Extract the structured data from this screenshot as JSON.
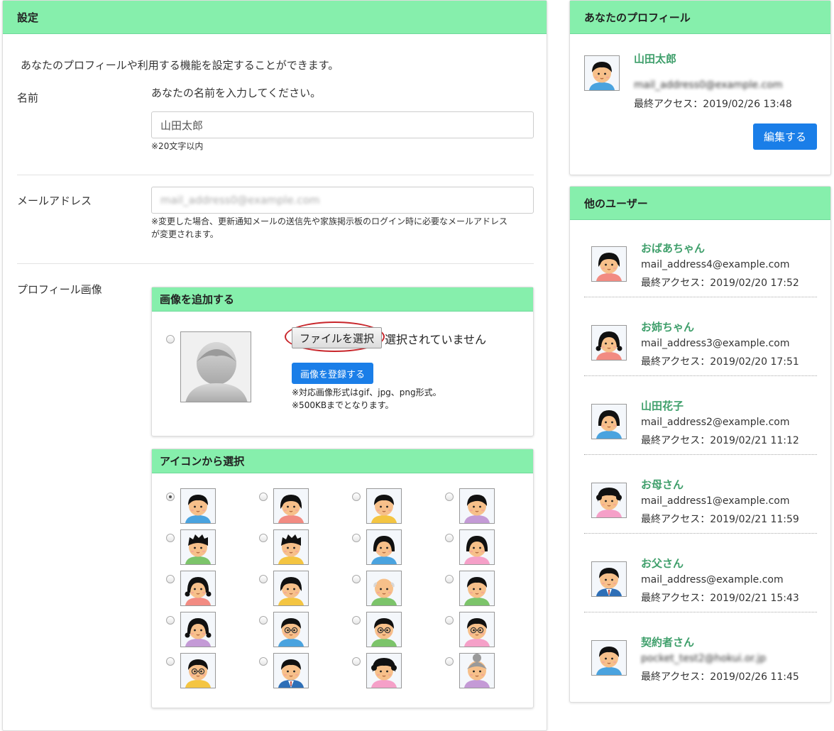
{
  "settings": {
    "title": "設定",
    "intro": "あなたのプロフィールや利用する機能を設定することができます。",
    "name_label": "名前",
    "name_help": "あなたの名前を入力してください。",
    "name_value": "山田太郎",
    "name_note": "※20文字以内",
    "email_label": "メールアドレス",
    "email_value": "mail_address0@example.com",
    "email_note_1": "※変更した場合、更新通知メールの送信先や家族掲示板のログイン時に必要なメールアドレス",
    "email_note_2": "が変更されます。",
    "image_label": "プロフィール画像",
    "add_image": {
      "title": "画像を追加する",
      "choose_file": "ファイルを選択",
      "no_file": "選択されていません",
      "register_button": "画像を登録する",
      "note_1": "※対応画像形式はgif、jpg、png形式。",
      "note_2": "※500KBまでとなります。"
    },
    "icon_select": {
      "title": "アイコンから選択",
      "selected_index": 0,
      "icons": [
        {
          "skin": "#f7c08a",
          "hair": "#111",
          "shirt": "#4aa3df",
          "style": "short"
        },
        {
          "skin": "#f7c08a",
          "hair": "#111",
          "shirt": "#f28b82",
          "style": "bob"
        },
        {
          "skin": "#f7c08a",
          "hair": "#111",
          "shirt": "#f4c542",
          "style": "short"
        },
        {
          "skin": "#f7c08a",
          "hair": "#111",
          "shirt": "#c49ad6",
          "style": "side"
        },
        {
          "skin": "#f7c08a",
          "hair": "#111",
          "shirt": "#7cc46a",
          "style": "spiky"
        },
        {
          "skin": "#f7c08a",
          "hair": "#111",
          "shirt": "#f4c542",
          "style": "spiky"
        },
        {
          "skin": "#f7c08a",
          "hair": "#111",
          "shirt": "#4aa3df",
          "style": "long"
        },
        {
          "skin": "#f7c08a",
          "hair": "#111",
          "shirt": "#f5a0c8",
          "style": "long"
        },
        {
          "skin": "#f7c08a",
          "hair": "#111",
          "shirt": "#f28b82",
          "style": "pigtail"
        },
        {
          "skin": "#f7c08a",
          "hair": "#111",
          "shirt": "#f4c542",
          "style": "bob"
        },
        {
          "skin": "#f7c08a",
          "hair": "#d8d8d8",
          "shirt": "#7cc46a",
          "style": "bald"
        },
        {
          "skin": "#f7c08a",
          "hair": "#111",
          "shirt": "#7cc46a",
          "style": "short"
        },
        {
          "skin": "#f7c08a",
          "hair": "#111",
          "shirt": "#c49ad6",
          "style": "pigtail"
        },
        {
          "skin": "#f7c08a",
          "hair": "#111",
          "shirt": "#4aa3df",
          "style": "glasses"
        },
        {
          "skin": "#f7c08a",
          "hair": "#111",
          "shirt": "#7cc46a",
          "style": "glasses"
        },
        {
          "skin": "#f7c08a",
          "hair": "#111",
          "shirt": "#f5a0c8",
          "style": "glasses"
        },
        {
          "skin": "#f7c08a",
          "hair": "#111",
          "shirt": "#f4c542",
          "style": "glasses"
        },
        {
          "skin": "#f7c08a",
          "hair": "#111",
          "shirt": "#2e6fb7",
          "style": "suit"
        },
        {
          "skin": "#f7c08a",
          "hair": "#111",
          "shirt": "#f5a0c8",
          "style": "curly"
        },
        {
          "skin": "#f7c08a",
          "hair": "#9a9a9a",
          "shirt": "#c49ad6",
          "style": "bun"
        }
      ]
    }
  },
  "profile": {
    "title": "あなたのプロフィール",
    "name": "山田太郎",
    "email": "mail_address0@example.com",
    "last_access": "最終アクセス：2019/02/26 13:48",
    "edit_button": "編集する",
    "avatar": {
      "skin": "#f7c08a",
      "hair": "#111",
      "shirt": "#4aa3df",
      "style": "short"
    }
  },
  "others": {
    "title": "他のユーザー",
    "users": [
      {
        "name": "おばあちゃん",
        "email": "mail_address4@example.com",
        "last_access": "最終アクセス：2019/02/20 17:52",
        "avatar": {
          "skin": "#f7c08a",
          "hair": "#111",
          "shirt": "#f28b82",
          "style": "bob"
        }
      },
      {
        "name": "お姉ちゃん",
        "email": "mail_address3@example.com",
        "last_access": "最終アクセス：2019/02/20 17:51",
        "avatar": {
          "skin": "#f7c08a",
          "hair": "#111",
          "shirt": "#f28b82",
          "style": "pigtail"
        }
      },
      {
        "name": "山田花子",
        "email": "mail_address2@example.com",
        "last_access": "最終アクセス：2019/02/21 11:12",
        "avatar": {
          "skin": "#f7c08a",
          "hair": "#111",
          "shirt": "#4aa3df",
          "style": "long"
        }
      },
      {
        "name": "お母さん",
        "email": "mail_address1@example.com",
        "last_access": "最終アクセス：2019/02/21 11:59",
        "avatar": {
          "skin": "#f7c08a",
          "hair": "#111",
          "shirt": "#f5a0c8",
          "style": "curly"
        }
      },
      {
        "name": "お父さん",
        "email": "mail_address@example.com",
        "last_access": "最終アクセス：2019/02/21 15:43",
        "avatar": {
          "skin": "#f7c08a",
          "hair": "#111",
          "shirt": "#2e6fb7",
          "style": "suit"
        }
      },
      {
        "name": "契約者さん",
        "email": "pocket_test2@hokui.or.jp",
        "last_access": "最終アクセス：2019/02/26 11:45",
        "avatar": {
          "skin": "#f7c08a",
          "hair": "#111",
          "shirt": "#4aa3df",
          "style": "short"
        }
      }
    ]
  }
}
